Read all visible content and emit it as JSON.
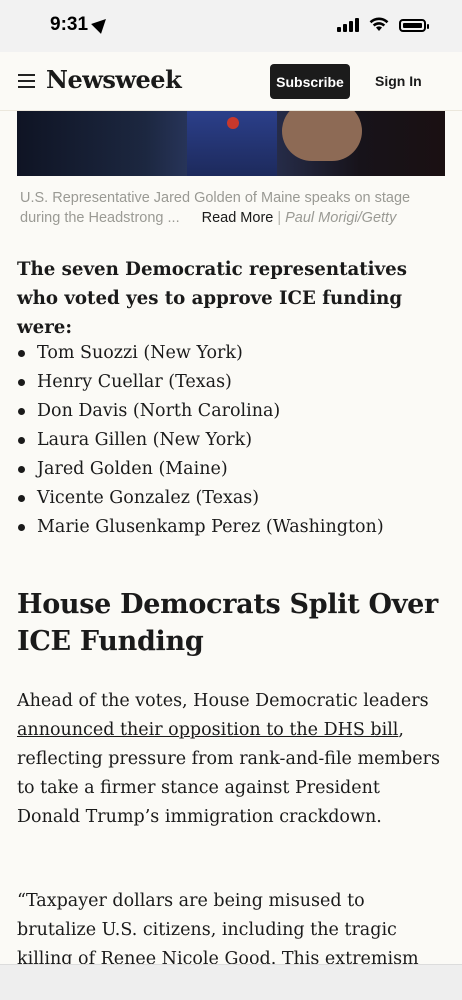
{
  "status_bar": {
    "time": "9:31"
  },
  "header": {
    "logo": "Newsweek",
    "subscribe_label": "Subscribe",
    "signin_label": "Sign In"
  },
  "caption": {
    "line1": "U.S. Representative Jared Golden of Maine speaks on stage",
    "line2": "during the Headstrong ...",
    "read_more": "Read More",
    "separator": "|",
    "credit": "Paul Morigi/Getty"
  },
  "article": {
    "lead": "The seven Democratic representatives who voted yes to approve ICE funding were:",
    "representatives": [
      "Tom Suozzi (New York)",
      "Henry Cuellar (Texas)",
      "Don Davis (North Carolina)",
      "Laura Gillen (New York)",
      "Jared Golden (Maine)",
      "Vicente Gonzalez (Texas)",
      "Marie Glusenkamp Perez (Washington)"
    ],
    "section_heading": "House Democrats Split Over ICE Funding",
    "para1_before": "Ahead of the votes, House Democratic leaders ",
    "para1_link": "announced their opposition to the DHS bill",
    "para1_after": ", reflecting pressure from rank-and-file members to take a firmer stance against President Donald Trump’s immigration crackdown.",
    "para2": "“Taxpayer dollars are being misused to brutalize U.S. citizens, including the tragic killing of Renee Nicole Good. This extremism"
  },
  "colors": {
    "page_background": "#fbfaf6",
    "subscribe_background": "#1b1b1b",
    "caption_text": "#9a9a94"
  }
}
